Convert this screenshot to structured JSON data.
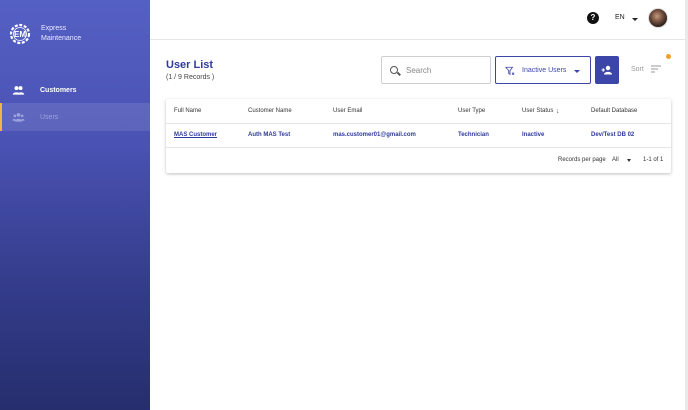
{
  "brand": {
    "line1": "Express",
    "line2": "Maintenance"
  },
  "sidebar": {
    "items": [
      {
        "label": "Customers",
        "icon": "people-icon",
        "active": false
      },
      {
        "label": "Users",
        "icon": "users-icon",
        "active": true
      }
    ]
  },
  "topbar": {
    "language": "EN",
    "help_icon": "help-icon",
    "avatar": "user-avatar"
  },
  "page": {
    "title": "User List",
    "records": "(1 / 9 Records )"
  },
  "search": {
    "placeholder": "Search",
    "value": ""
  },
  "filter": {
    "label": "Inactive Users"
  },
  "sort": {
    "label": "Sort"
  },
  "table": {
    "columns": [
      "Full Name",
      "Customer Name",
      "User Email",
      "User Type",
      "User Status",
      "Default Database"
    ],
    "rows": [
      [
        "MAS Customer",
        "Auth MAS Test",
        "mas.customer01@gmail.com",
        "Technician",
        "Inactive",
        "Dev/Test DB 02"
      ]
    ],
    "sort_arrow": "↓"
  },
  "pagination": {
    "rows_per_page_label": "Records per page",
    "rows_per_page": "All",
    "range": "1-1 of 1"
  },
  "colors": {
    "accent": "#3c46a8",
    "sidebar_top": "#5560c4",
    "sidebar_bottom": "#262e6e",
    "notification": "#f2a02b"
  }
}
